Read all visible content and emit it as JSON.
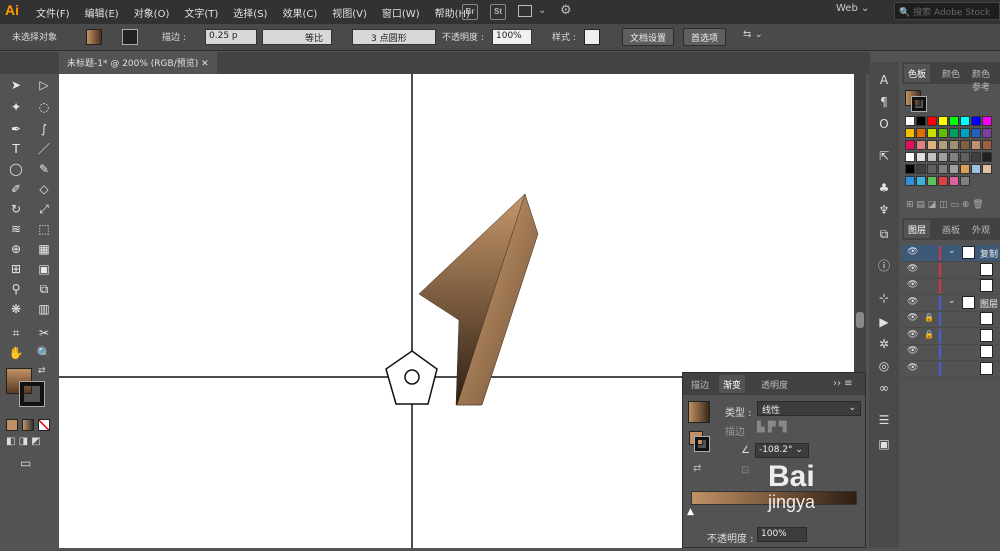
{
  "app": {
    "logo": "Ai",
    "menus": [
      "文件(F)",
      "编辑(E)",
      "对象(O)",
      "文字(T)",
      "选择(S)",
      "效果(C)",
      "视图(V)",
      "窗口(W)",
      "帮助(H)"
    ],
    "bridge_label": "Br",
    "stock_label": "St",
    "workspace": "Web",
    "search_placeholder": "搜索 Adobe Stock"
  },
  "control": {
    "selection_status": "未选择对象",
    "stroke_label": "描边 :",
    "stroke_value": "0.25 p",
    "stroke_profile": "等比",
    "brush": "3 点圆形",
    "opacity_label": "不透明度 :",
    "opacity_value": "100%",
    "style_label": "样式 :",
    "doc_setup": "文档设置",
    "prefs": "首选项"
  },
  "document": {
    "tab_title": "未标题-1* @ 200% (RGB/预览)"
  },
  "panels": {
    "swatches": {
      "tabs": [
        "色板",
        "颜色",
        "颜色参考"
      ],
      "colors": [
        "#ffffff",
        "#000000",
        "#ff0000",
        "#ffff00",
        "#00ff00",
        "#00ffff",
        "#0000ff",
        "#ff00ff",
        "#f0c000",
        "#e07000",
        "#c8e000",
        "#60c000",
        "#00a060",
        "#00a0c0",
        "#2060c0",
        "#8040a0",
        "#e01060",
        "#e08080",
        "#e0b080",
        "#b0a080",
        "#a09070",
        "#806040",
        "#c09070",
        "#a06040",
        "#ffffff",
        "#e0e0e0",
        "#c0c0c0",
        "#a0a0a0",
        "#808080",
        "#606060",
        "#404040",
        "#202020",
        "#000000",
        "#404040",
        "#606060",
        "#808080",
        "#a0a0a0",
        "#d8a050",
        "#a0c0e0",
        "#e0c0a0",
        "#3090e0",
        "#40b0e0",
        "#60c060",
        "#e04040",
        "#e060a0",
        "#808080"
      ]
    },
    "layers": {
      "tabs": [
        "图层",
        "画板",
        "外观"
      ],
      "rows": [
        {
          "name": "复制"
        },
        {
          "name": ""
        },
        {
          "name": ""
        },
        {
          "name": "图层"
        },
        {
          "name": ""
        },
        {
          "name": ""
        },
        {
          "name": ""
        },
        {
          "name": ""
        }
      ]
    },
    "gradient": {
      "tabs": [
        "描边",
        "渐变",
        "透明度"
      ],
      "type_label": "类型 :",
      "type_value": "线性",
      "stroke_label": "描边",
      "angle_value": "-108.2°",
      "opacity_label": "不透明度 :",
      "opacity_value": "100%"
    }
  },
  "watermark": {
    "line1": "Bai",
    "line2": "jingya"
  }
}
